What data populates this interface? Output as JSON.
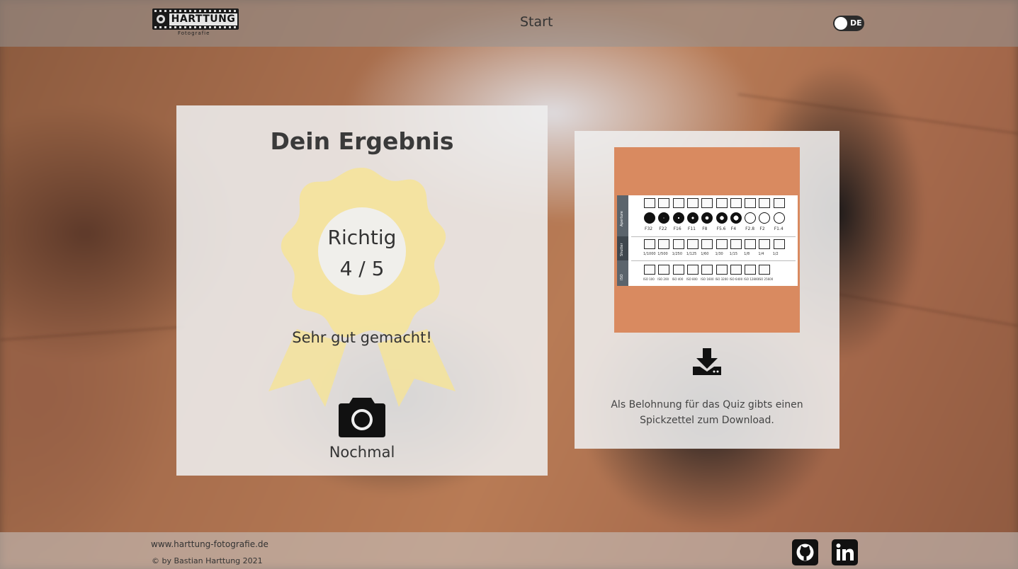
{
  "header": {
    "logo_text": "HARTTUNG",
    "logo_subtext": "Fotografie",
    "nav_start": "Start",
    "language": "DE"
  },
  "result": {
    "title": "Dein Ergebnis",
    "score_label": "Richtig",
    "score_value": "4 / 5",
    "praise": "Sehr gut gemacht!",
    "retry_label": "Nochmal",
    "rosette_color": "#f5e39a"
  },
  "download": {
    "text": "Als Belohnung für das Quiz gibts einen Spickzettel zum Download.",
    "image_bg": "#d98a60",
    "sheet_sections": [
      "Aperture",
      "Shutter",
      "ISO"
    ],
    "aperture_values": [
      "F32",
      "F22",
      "F16",
      "F11",
      "F8",
      "F5.6",
      "F4",
      "F2.8",
      "F2",
      "F1.4"
    ],
    "shutter_values": [
      "1/1000",
      "1/500",
      "1/250",
      "1/125",
      "1/60",
      "1/30",
      "1/15",
      "1/8",
      "1/4",
      "1/2"
    ],
    "iso_values": [
      "ISO 100",
      "ISO 200",
      "ISO 400",
      "ISO 800",
      "ISO 1600",
      "ISO 3200",
      "ISO 6400",
      "ISO 12800",
      "ISO 25600"
    ]
  },
  "footer": {
    "url": "www.harttung-fotografie.de",
    "copyright": "© by Bastian Harttung 2021",
    "icons": [
      "github-icon",
      "linkedin-icon"
    ]
  }
}
